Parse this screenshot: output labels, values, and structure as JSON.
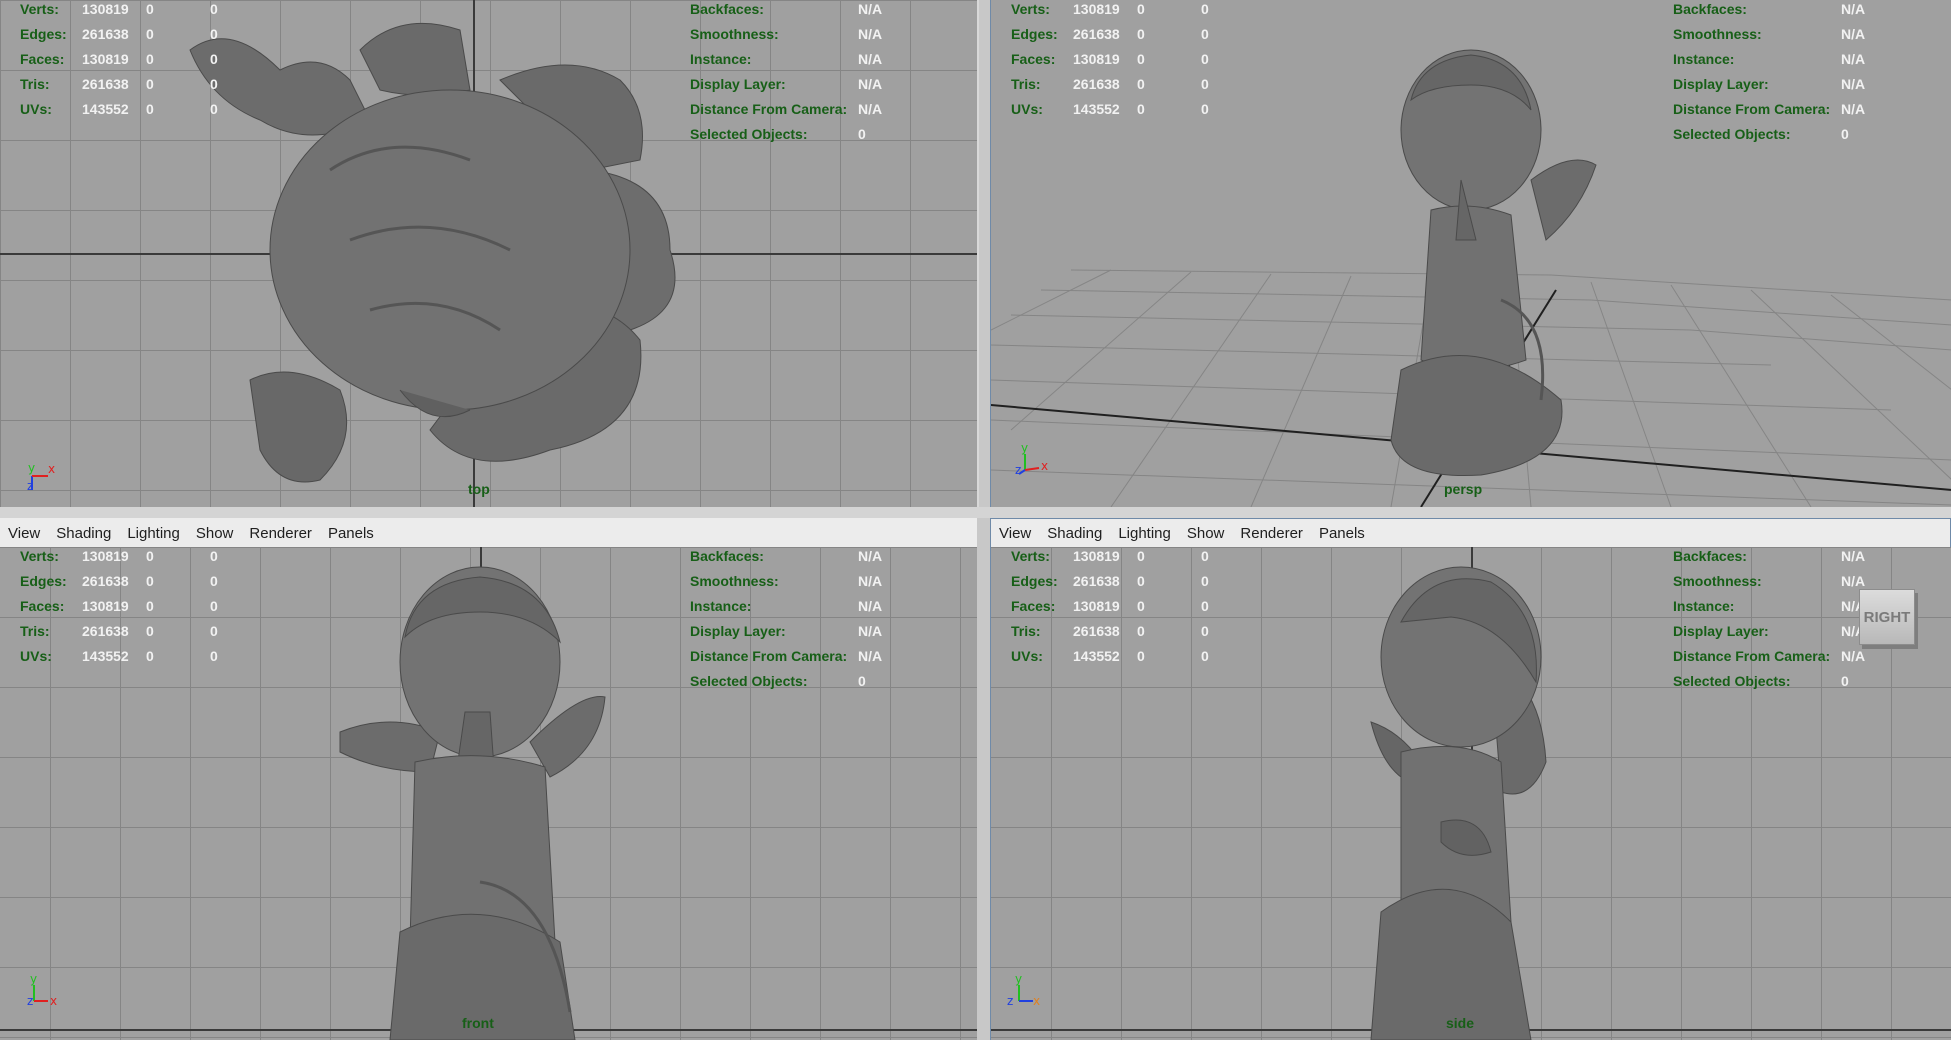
{
  "hud_stats": {
    "labels": [
      "Verts:",
      "Edges:",
      "Faces:",
      "Tris:",
      "UVs:"
    ],
    "values": [
      [
        "130819",
        "0",
        "0"
      ],
      [
        "261638",
        "0",
        "0"
      ],
      [
        "130819",
        "0",
        "0"
      ],
      [
        "261638",
        "0",
        "0"
      ],
      [
        "143552",
        "0",
        "0"
      ]
    ]
  },
  "hud_info": {
    "labels": [
      "Backfaces:",
      "Smoothness:",
      "Instance:",
      "Display Layer:",
      "Distance From Camera:",
      "Selected Objects:"
    ],
    "values": [
      "N/A",
      "N/A",
      "N/A",
      "N/A",
      "N/A",
      "0"
    ]
  },
  "menu": [
    "View",
    "Shading",
    "Lighting",
    "Show",
    "Renderer",
    "Panels"
  ],
  "cameras": {
    "top": "top",
    "persp": "persp",
    "front": "front",
    "side": "side"
  },
  "view_cube_label": "RIGHT",
  "axes": {
    "top": [
      "y",
      "x",
      "z"
    ],
    "persp": [
      "y",
      "x",
      "z"
    ],
    "front": [
      "y",
      "x",
      "z"
    ],
    "side": [
      "y",
      "x",
      "z"
    ]
  },
  "colors": {
    "viewport_bg": "#a0a0a0",
    "grid_line": "#858585",
    "hud_label": "#175f17",
    "hud_value": "#f2f2f2",
    "model": "#6c6c6c",
    "axis_x": "#e02020",
    "axis_y": "#20c020",
    "axis_z": "#2040e0"
  }
}
